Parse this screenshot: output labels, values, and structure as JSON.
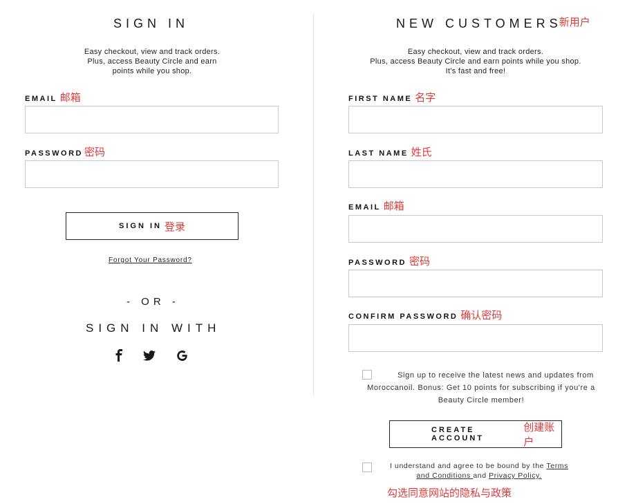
{
  "sign_in": {
    "heading": "SIGN IN",
    "subtext": [
      "Easy checkout, view and track orders.",
      "Plus, access Beauty Circle and earn",
      "points while you shop."
    ],
    "email_label": "EMAIL",
    "email_label_cn": "邮箱",
    "email_value": "",
    "password_label": "PASSWORD",
    "password_label_cn": "密码",
    "password_value": "",
    "button_label": "SIGN IN",
    "button_label_cn": "登录",
    "forgot_link": "Forgot Your Password?",
    "or_text": "- OR -",
    "sign_in_with": "SIGN IN WITH",
    "social_icons": [
      "facebook-icon",
      "twitter-icon",
      "google-icon"
    ]
  },
  "new_customers": {
    "heading": "NEW CUSTOMERS",
    "heading_cn": "新用户",
    "subtext": [
      "Easy checkout, view and track orders.",
      "Plus, access Beauty Circle and earn points while you shop.",
      "It's fast and free!"
    ],
    "first_name_label": "FIRST NAME",
    "first_name_cn": "名字",
    "last_name_label": "LAST NAME",
    "last_name_cn": "姓氏",
    "email_label": "EMAIL",
    "email_cn": "邮箱",
    "password_label": "PASSWORD",
    "password_cn": "密码",
    "confirm_password_label": "CONFIRM PASSWORD",
    "confirm_password_cn": "确认密码",
    "newsletter_text": [
      "Sign up to receive the latest news and updates from",
      "Moroccanoil. Bonus: Get 10 points for subscribing if you're a",
      "Beauty Circle member!"
    ],
    "newsletter_checked": false,
    "create_button_label": "CREATE ACCOUNT",
    "create_button_cn": "创建账户",
    "terms_prefix": "I understand and agree to be bound by the ",
    "terms_link_1": "Terms",
    "terms_link_2": "and Conditions ",
    "terms_and": "and ",
    "terms_link_3": "Privacy Policy.",
    "terms_checked": false,
    "terms_note_cn": "勾选同意网站的隐私与政策"
  }
}
